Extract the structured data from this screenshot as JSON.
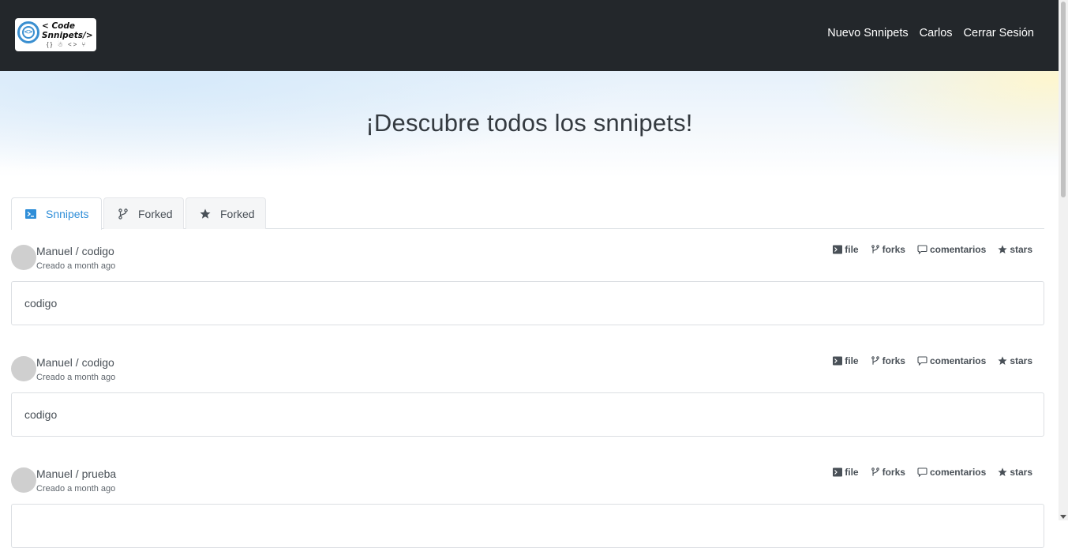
{
  "navbar": {
    "logo_text_line1": "< Code",
    "logo_text_line2": "Snnipets/>",
    "logo_mini_icons": "{} ☃ <> ⑂",
    "links": [
      "Nuevo Snnipets",
      "Carlos",
      "Cerrar Sesión"
    ]
  },
  "hero": {
    "title": "¡Descubre todos los snnipets!"
  },
  "tabs": [
    {
      "label": "Snnipets",
      "icon": "terminal-icon",
      "active": true
    },
    {
      "label": "Forked",
      "icon": "fork-icon",
      "active": false
    },
    {
      "label": "Forked",
      "icon": "star-icon",
      "active": false
    }
  ],
  "actions": {
    "file": "file",
    "forks": "forks",
    "comments": "comentarios",
    "stars": "stars"
  },
  "snippets": [
    {
      "title": "Manuel / codigo",
      "date": "Creado a month ago",
      "content": "codigo"
    },
    {
      "title": "Manuel / codigo",
      "date": "Creado a month ago",
      "content": "codigo"
    },
    {
      "title": "Manuel / prueba",
      "date": "Creado a month ago",
      "content": ""
    }
  ],
  "colors": {
    "navbar_bg": "#23272b",
    "accent": "#2f8ed8",
    "text": "#495057"
  }
}
